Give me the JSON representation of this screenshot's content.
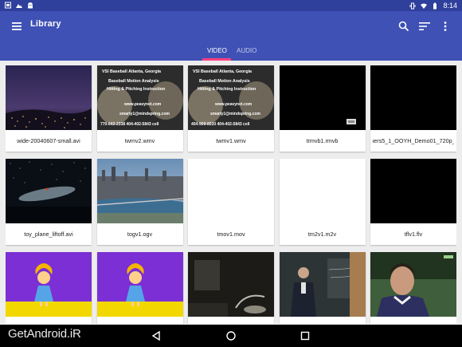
{
  "status_bar": {
    "time": "8:14",
    "left_icons": [
      "gallery-icon",
      "photo-icon",
      "android-icon"
    ],
    "right_icons": [
      "vibrate-icon",
      "wifi-icon",
      "battery-icon"
    ]
  },
  "app_bar": {
    "title": "Library",
    "menu_icon": "menu-icon",
    "actions": [
      "search-icon",
      "sort-icon",
      "more-vert-icon"
    ]
  },
  "tabs": [
    {
      "label": "VIDEO",
      "active": true
    },
    {
      "label": "AUDIO",
      "active": false
    }
  ],
  "videos": [
    {
      "title": "wide-20040607-small.avi",
      "thumb": "night-city"
    },
    {
      "title": "twmv2.wmv",
      "thumb": "baseball-slide",
      "overlay": {
        "line1": "VSI Baseball     Atlanta, Georgia",
        "line2": "Baseball Motion Analysis",
        "line3": "Hitting & Pitching Instruction",
        "web": "www.peavynet.com",
        "email": "smarty1@mindspring.com",
        "phone": "770-642-2338    404-402-5843 cell"
      }
    },
    {
      "title": "twmv1.wmv",
      "thumb": "baseball-slide",
      "overlay": {
        "line1": "VSI Baseball     Atlanta, Georgia",
        "line2": "Baseball Motion Analysis",
        "line3": "Hitting & Pitching Instruction",
        "web": "www.peavynet.com",
        "email": "smarty1@mindspring.com",
        "phone": "404-909-8020    404-402-5843 cell"
      }
    },
    {
      "title": "trmvb1.rmvb",
      "thumb": "black-small-logo"
    },
    {
      "title": "Transformers5_1_OOYH_Demo01_720p_5Mbps....",
      "thumb": "black"
    },
    {
      "title": "toy_plane_liftoff.avi",
      "thumb": "starfield"
    },
    {
      "title": "togv1.ogv",
      "thumb": "city-river"
    },
    {
      "title": "tmov1.mov",
      "thumb": "white"
    },
    {
      "title": "tm2v1.m2v",
      "thumb": "white"
    },
    {
      "title": "tflv1.flv",
      "thumb": "black"
    },
    {
      "title": "",
      "thumb": "cartoon-girl"
    },
    {
      "title": "",
      "thumb": "cartoon-girl"
    },
    {
      "title": "",
      "thumb": "dark-room"
    },
    {
      "title": "",
      "thumb": "lecture"
    },
    {
      "title": "",
      "thumb": "soccer-player"
    }
  ],
  "nav_bar": {
    "buttons": [
      "back-icon",
      "home-icon",
      "recents-icon"
    ]
  },
  "watermark": "GetAndroid.iR",
  "colors": {
    "primary": "#3f51b5",
    "primary_dark": "#2f3f9c",
    "accent": "#ff4081",
    "background": "#ededed"
  }
}
